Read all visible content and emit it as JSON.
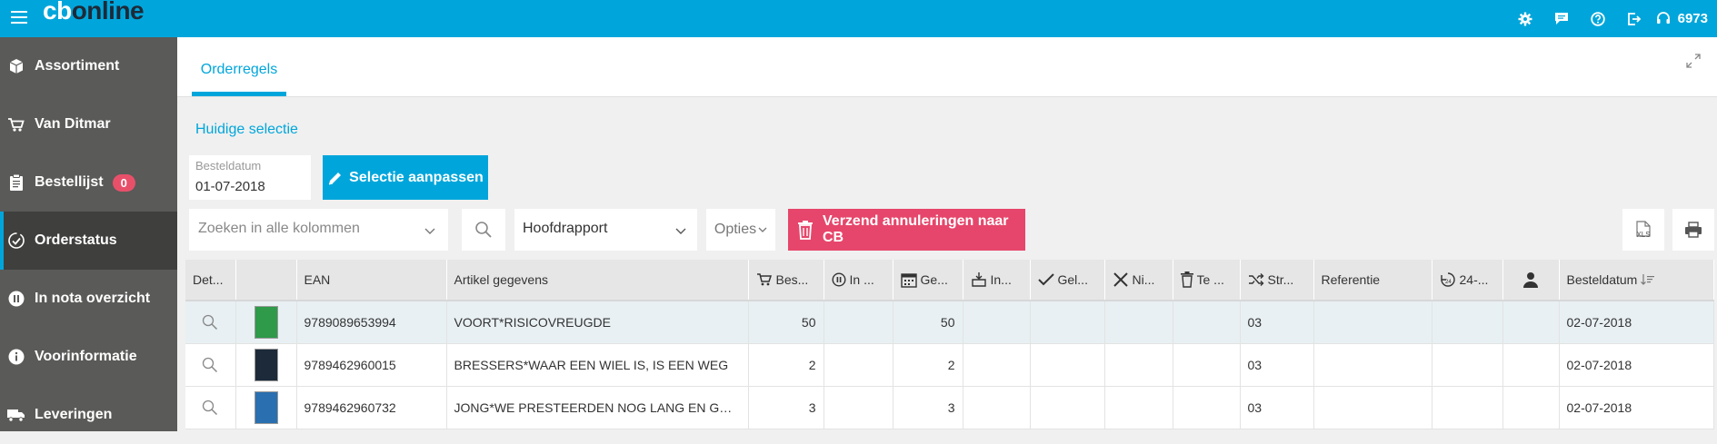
{
  "topbar": {
    "logo_cb": "cb",
    "logo_online": "online",
    "icons": [
      "gear-icon",
      "chat-icon",
      "help-icon",
      "logout-icon",
      "headset-icon"
    ],
    "count": "6973"
  },
  "sidebar": {
    "items": [
      {
        "label": "Assortiment",
        "icon": "box-icon"
      },
      {
        "label": "Van Ditmar",
        "icon": "cart-icon"
      },
      {
        "label": "Bestellijst",
        "icon": "clipboard-icon",
        "badge": "0"
      },
      {
        "label": "Orderstatus",
        "icon": "check-circle-icon",
        "active": true
      },
      {
        "label": "In nota overzicht",
        "icon": "pause-circle-icon"
      },
      {
        "label": "Voorinformatie",
        "icon": "info-circle-icon"
      },
      {
        "label": "Leveringen",
        "icon": "truck-icon"
      }
    ]
  },
  "tabs": [
    {
      "label": "Orderregels"
    }
  ],
  "selection": {
    "title": "Huidige selectie",
    "date_label": "Besteldatum",
    "date_value": "01-07-2018",
    "adjust_button": "Selectie aanpassen"
  },
  "toolbar": {
    "search_placeholder": "Zoeken in alle kolommen",
    "report_value": "Hoofdrapport",
    "options_label": "Opties",
    "cancel_button": "Verzend annuleringen naar CB",
    "xls_label": "XLS"
  },
  "table": {
    "headers": [
      "Det...",
      "",
      "EAN",
      "Artikel gegevens",
      "Bes...",
      "In ...",
      "Ge...",
      "In...",
      "Gel...",
      "Ni...",
      "Te ...",
      "Str...",
      "Referentie",
      "24-...",
      "",
      "Besteldatum"
    ],
    "rows": [
      {
        "ean": "9789089653994",
        "artikel": "VOORT*RISICOVREUGDE",
        "besteld": "50",
        "geleverd_col": "50",
        "str": "03",
        "datum": "02-07-2018",
        "cover_color": "#2e9a4a"
      },
      {
        "ean": "9789462960015",
        "artikel": "BRESSERS*WAAR EEN WIEL IS, IS EEN WEG",
        "besteld": "2",
        "geleverd_col": "2",
        "str": "03",
        "datum": "02-07-2018",
        "cover_color": "#1c2a3a"
      },
      {
        "ean": "9789462960732",
        "artikel": "JONG*WE PRESTEERDEN NOG LANG EN GELUKKIG",
        "besteld": "3",
        "geleverd_col": "3",
        "str": "03",
        "datum": "02-07-2018",
        "cover_color": "#2a6fb0"
      }
    ]
  },
  "colors": {
    "accent": "#00a6db",
    "danger": "#e6466b",
    "sidebar": "#5a5a58"
  }
}
